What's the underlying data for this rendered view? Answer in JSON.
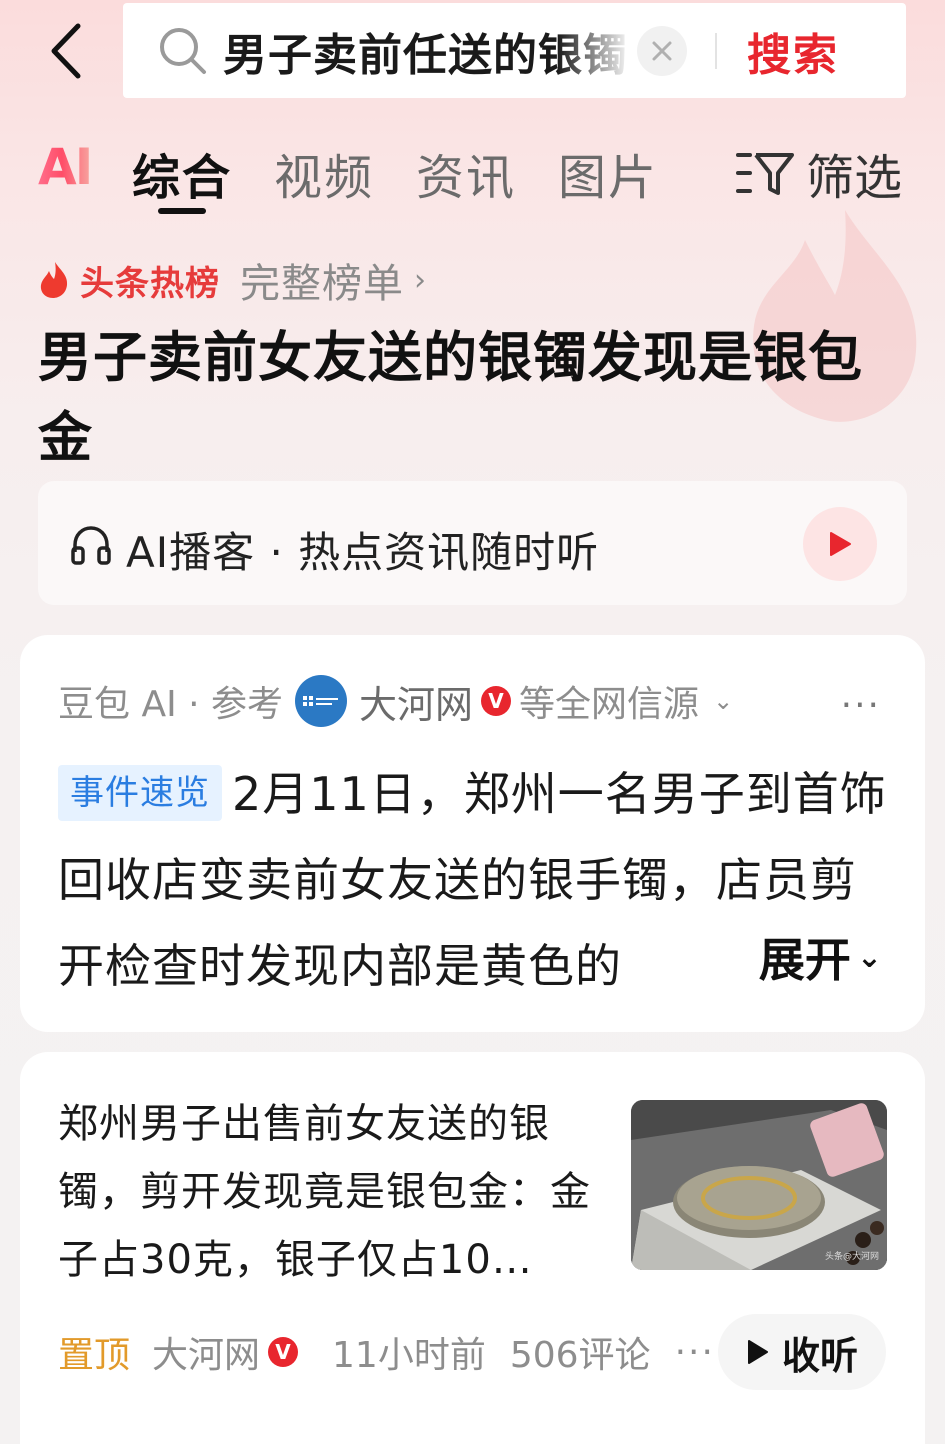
{
  "search": {
    "query": "男子卖前任送的银镯",
    "submit_label": "搜索",
    "back_icon": "chevron-left-icon",
    "clear_icon": "close-icon"
  },
  "tabs": {
    "ai_label": "AI",
    "items": [
      {
        "label": "综合",
        "active": true
      },
      {
        "label": "视频",
        "active": false
      },
      {
        "label": "资讯",
        "active": false
      },
      {
        "label": "图片",
        "active": false
      }
    ],
    "filter_label": "筛选"
  },
  "hot": {
    "label": "头条热榜",
    "more_label": "完整榜单",
    "chevron": "›",
    "headline": "男子卖前女友送的银镯发现是银包金"
  },
  "podcast": {
    "label": "AI播客 · 热点资讯随时听"
  },
  "summary": {
    "source_prefix": "豆包 AI · 参考",
    "source_name": "大河网",
    "source_suffix": "等全网信源",
    "chevron": "⌄",
    "menu": "···",
    "tag": "事件速览",
    "text": "2月11日，郑州一名男子到首饰回收店变卖前女友送的银手镯，店员剪开检查时发现内部是黄色的",
    "expand_label": "展开",
    "expand_chevron": "⌄"
  },
  "news": {
    "title": "郑州男子出售前女友送的银镯，剪开发现竟是银包金：金子占30克，银子仅占10…",
    "pinned": "置顶",
    "source": "大河网",
    "time": "11小时前",
    "comments": "506评论",
    "menu": "···",
    "listen_label": "收听",
    "thumb_watermark": "头条@大河网"
  },
  "badges": {
    "verified": "V"
  },
  "colors": {
    "accent_red": "#e8262e",
    "tag_blue": "#2a7de1",
    "pinned_orange": "#e29a2a"
  }
}
